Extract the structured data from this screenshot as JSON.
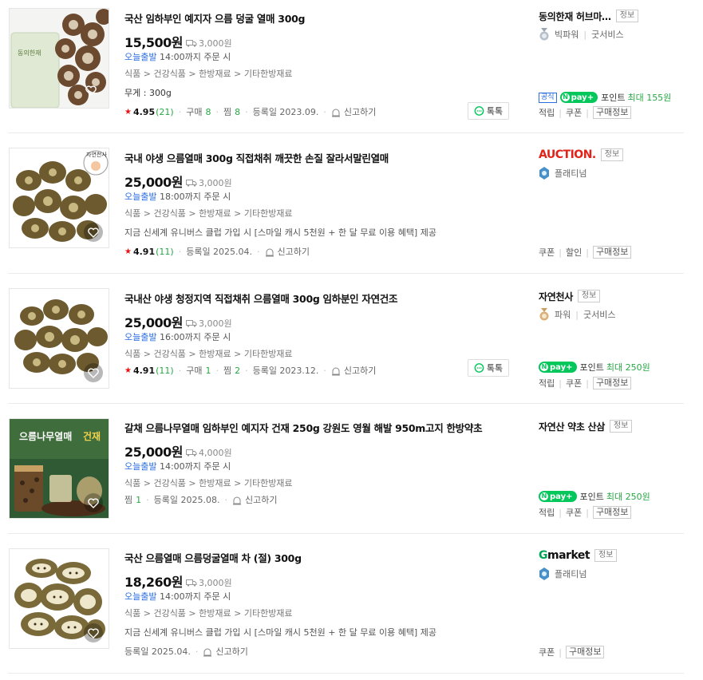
{
  "products": [
    {
      "title": "국산 임하부인 예지자 으름 덩굴 열매 300g",
      "price": "15,500원",
      "shipping": "3,000원",
      "today_label": "오늘출발",
      "today_text": " 14:00까지 주문 시",
      "category": "식품 > 건강식품 > 한방재료 > 기타한방재료",
      "extra": "무게 : 300g",
      "rating": "4.95",
      "reviews": "(21)",
      "purchase_label": "구매",
      "purchase": "8",
      "zzim_label": "찜",
      "zzim": "8",
      "date": "등록일 2023.09.",
      "report": "신고하기",
      "talk": "톡톡",
      "seller": {
        "name": "동의한재 허브마…",
        "info": "정보",
        "grade": "빅파워",
        "service": "굿서비스",
        "official": "공식",
        "npay": "pay",
        "point_label": "포인트",
        "point_max": "최대 155원",
        "links": [
          "적립",
          "쿠폰",
          "구매정보"
        ]
      }
    },
    {
      "title": "국내 야생 으름열매 300g 직접채취 깨끗한 손질 잘라서말린열매",
      "price": "25,000원",
      "shipping": "3,000원",
      "today_label": "오늘출발",
      "today_text": " 18:00까지 주문 시",
      "category": "식품 > 건강식품 > 한방재료 > 기타한방재료",
      "extra": "지금 신세계 유니버스 클럽 가입 시 [스마일 캐시 5천원 + 한 달 무료 이용 혜택] 제공",
      "rating": "4.91",
      "reviews": "(11)",
      "date": "등록일 2025.04.",
      "report": "신고하기",
      "thumb_badge": "자연천사",
      "seller": {
        "logo": "AUCTION.",
        "info": "정보",
        "grade": "플래티넘",
        "links": [
          "쿠폰",
          "할인",
          "구매정보"
        ]
      }
    },
    {
      "title": "국내산 야생 청정지역 직접채취 으름열매 300g 임하분인 자연건조",
      "price": "25,000원",
      "shipping": "3,000원",
      "today_label": "오늘출발",
      "today_text": " 16:00까지 주문 시",
      "category": "식품 > 건강식품 > 한방재료 > 기타한방재료",
      "rating": "4.91",
      "reviews": "(11)",
      "purchase_label": "구매",
      "purchase": "1",
      "zzim_label": "찜",
      "zzim": "2",
      "date": "등록일 2023.12.",
      "report": "신고하기",
      "talk": "톡톡",
      "seller": {
        "name": "자연천사",
        "info": "정보",
        "grade": "파워",
        "service": "굿서비스",
        "npay": "pay",
        "point_label": "포인트",
        "point_max": "최대 250원",
        "links": [
          "적립",
          "쿠폰",
          "구매정보"
        ]
      }
    },
    {
      "title": "갈채 으름나무열매 임하부인 예지자 건재 250g 강원도 영월 해발 950m고지 한방약초",
      "price": "25,000원",
      "shipping": "4,000원",
      "today_label": "오늘출발",
      "today_text": " 14:00까지 주문 시",
      "category": "식품 > 건강식품 > 한방재료 > 기타한방재료",
      "zzim_label": "찜",
      "zzim": "1",
      "date": "등록일 2025.08.",
      "report": "신고하기",
      "thumb_title_a": "으름나무열매",
      "thumb_title_b": "건재",
      "seller": {
        "name": "자연산 약초 산삼",
        "info": "정보",
        "npay": "pay",
        "point_label": "포인트",
        "point_max": "최대 250원",
        "links": [
          "적립",
          "쿠폰",
          "구매정보"
        ]
      }
    },
    {
      "title": "국산 으름열매 으름덩굴열매 차 (절) 300g",
      "price": "18,260원",
      "shipping": "3,000원",
      "today_label": "오늘출발",
      "today_text": " 14:00까지 주문 시",
      "category": "식품 > 건강식품 > 한방재료 > 기타한방재료",
      "extra": "지금 신세계 유니버스 클럽 가입 시 [스마일 캐시 5천원 + 한 달 무료 이용 혜택] 제공",
      "date": "등록일 2025.04.",
      "report": "신고하기",
      "seller": {
        "logo_g": "G",
        "logo_rest": "market",
        "info": "정보",
        "grade": "플래티넘",
        "links": [
          "쿠폰",
          "구매정보"
        ]
      }
    }
  ],
  "colors": {
    "accent_blue": "#2a6ee0",
    "green": "#28a745",
    "npay_green": "#03c75a",
    "star_red": "#e11111",
    "auction_red": "#e2231a"
  }
}
